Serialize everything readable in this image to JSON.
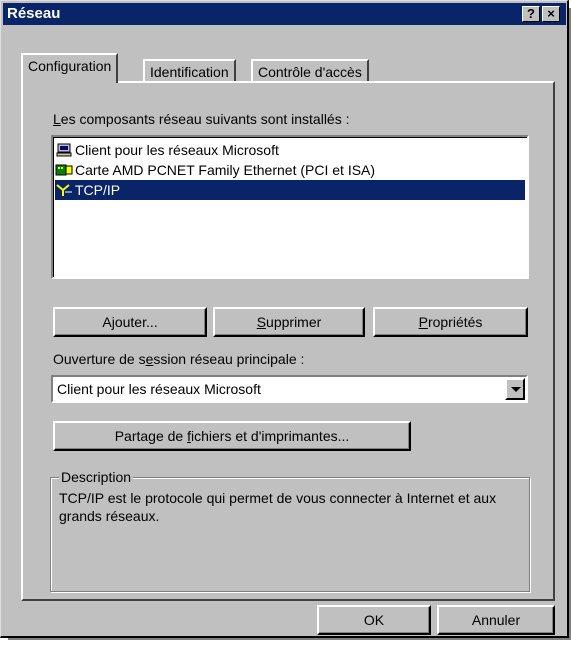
{
  "window": {
    "title": "Réseau",
    "help_label": "?",
    "close_label": "×"
  },
  "tabs": [
    {
      "label": "Configuration",
      "active": true
    },
    {
      "label": "Identification",
      "active": false
    },
    {
      "label": "Contrôle d'accès",
      "active": false
    }
  ],
  "components": {
    "label_prefix": "L",
    "label_rest": "es composants réseau suivants sont installés :",
    "items": [
      {
        "label": "Client pour les réseaux Microsoft",
        "icon": "network-client-icon",
        "selected": false
      },
      {
        "label": "Carte AMD PCNET Family Ethernet (PCI et ISA)",
        "icon": "network-adapter-icon",
        "selected": false
      },
      {
        "label": "TCP/IP",
        "icon": "protocol-icon",
        "selected": true
      }
    ]
  },
  "actions": {
    "add_pre": "A",
    "add_u": "j",
    "add_post": "outer...",
    "remove_u": "S",
    "remove_post": "upprimer",
    "properties_u": "P",
    "properties_post": "ropriétés"
  },
  "logon": {
    "label_pre": "Ouverture de s",
    "label_u": "e",
    "label_post": "ssion réseau principale :",
    "selected": "Client pour les réseaux Microsoft"
  },
  "sharing": {
    "pre": "Partage de ",
    "u": "f",
    "post": "ichiers et d'imprimantes..."
  },
  "description": {
    "legend": "Description",
    "text": "TCP/IP est le protocole qui permet de vous connecter à Internet et aux grands réseaux."
  },
  "footer": {
    "ok_label": "OK",
    "cancel_label": "Annuler"
  },
  "colors": {
    "face": "#c0c0c0",
    "titlebar": "#0a246a",
    "selection": "#0a246a"
  }
}
